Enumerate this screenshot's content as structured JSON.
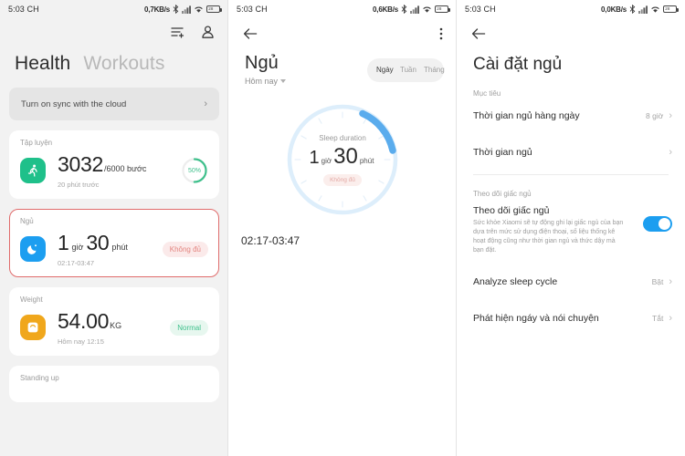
{
  "panel1": {
    "statusbar": {
      "time": "5:03 CH",
      "network": "0,7KB/s",
      "battery": "28"
    },
    "icons": {
      "list_add": "list-add-icon",
      "account": "account-icon"
    },
    "title_main": "Health",
    "title_secondary": "Workouts",
    "sync_banner": {
      "label": "Turn on sync with the cloud",
      "chevron": "›"
    },
    "cards": [
      {
        "section": "Tập luyện",
        "icon": "running-icon",
        "value": "3032",
        "unit": "/6000 bước",
        "sub": "20 phút trước",
        "ring_percent": "50%",
        "ring_value": 50
      },
      {
        "section": "Ngủ",
        "icon": "sleep-moon-icon",
        "value_hours": "1",
        "unit_hours": "giờ",
        "value_minutes": "30",
        "unit_minutes": "phút",
        "sub": "02:17-03:47",
        "badge": "Không đủ"
      },
      {
        "section": "Weight",
        "icon": "weight-scale-icon",
        "value": "54.00",
        "unit": "KG",
        "sub": "Hôm nay 12:15",
        "badge": "Normal"
      },
      {
        "section": "Standing up"
      }
    ]
  },
  "panel2": {
    "statusbar": {
      "time": "5:03 CH",
      "network": "0,6KB/s",
      "battery": "28"
    },
    "back": "back-arrow-icon",
    "overflow": "more-options-icon",
    "title": "Ngủ",
    "subtitle": "Hôm nay",
    "segments": [
      {
        "label": "Ngày",
        "active": true
      },
      {
        "label": "Tuần",
        "active": false
      },
      {
        "label": "Tháng",
        "active": false
      }
    ],
    "clock": {
      "label": "Sleep duration",
      "hours": "1",
      "hours_unit": "giờ",
      "minutes": "30",
      "minutes_unit": "phút",
      "badge": "Không đủ",
      "arc_color": "#5aaced",
      "track_color": "#ddeefb"
    },
    "time_range": "02:17-03:47"
  },
  "panel3": {
    "statusbar": {
      "time": "5:03 CH",
      "network": "0,0KB/s",
      "battery": "28"
    },
    "back": "back-arrow-icon",
    "title": "Cài đặt ngủ",
    "section_goal": "Mục tiêu",
    "rows_goal": [
      {
        "title": "Thời gian ngủ hàng ngày",
        "value": "8 giờ",
        "chevron": "›"
      },
      {
        "title": "Thời gian ngủ",
        "value": "",
        "chevron": "›"
      }
    ],
    "section_tracking": "Theo dõi giấc ngủ",
    "tracking": {
      "title": "Theo dõi giấc ngủ",
      "description": "Sức khỏe Xiaomi sẽ tự động ghi lại giấc ngủ của bạn dựa trên mức sử dụng điện thoại, số liệu thống kê hoạt động cũng như thời gian ngủ và thức dậy mà bạn đặt.",
      "toggle_on": true,
      "toggle_color": "#1c9ef0"
    },
    "rows_tracking": [
      {
        "title": "Analyze sleep cycle",
        "value": "Bật",
        "chevron": "›"
      },
      {
        "title": "Phát hiện ngáy và nói chuyện",
        "value": "Tắt",
        "chevron": "›"
      }
    ]
  }
}
